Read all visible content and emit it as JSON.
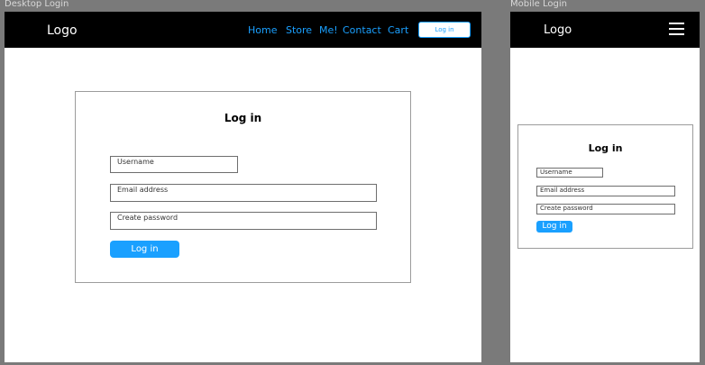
{
  "desktop": {
    "frame_label": "Desktop Login",
    "logo": "Logo",
    "nav": {
      "home": "Home",
      "store": "Store",
      "me": "Me!",
      "contact": "Contact",
      "cart": "Cart",
      "login_button": "Log in"
    },
    "form": {
      "title": "Log in",
      "username_placeholder": "Username",
      "email_placeholder": "Email address",
      "password_placeholder": "Create password",
      "submit_label": "Log in"
    }
  },
  "mobile": {
    "frame_label": "Mobile Login",
    "logo": "Logo",
    "form": {
      "title": "Log in",
      "username_placeholder": "Username",
      "email_placeholder": "Email address",
      "password_placeholder": "Create password",
      "submit_label": "Log in"
    }
  },
  "colors": {
    "background": "#7a7a7a",
    "navbar": "#000000",
    "accent": "#1aa0ff",
    "frame": "#ffffff"
  }
}
